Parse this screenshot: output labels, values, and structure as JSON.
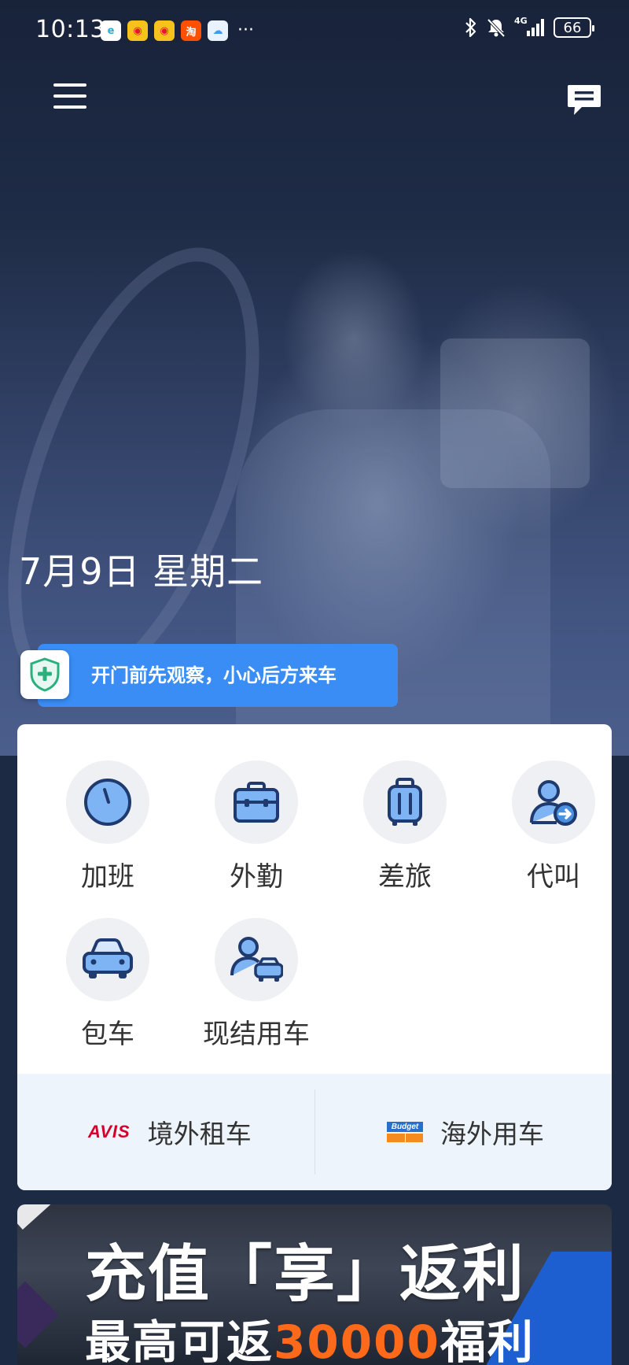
{
  "status_bar": {
    "time": "10:13",
    "apps": [
      {
        "icon": "app-e-icon",
        "label": "e",
        "color": "#2aa8d8"
      },
      {
        "icon": "weibo-icon",
        "label": "◉",
        "color": "#e6162d"
      },
      {
        "icon": "weibo-icon",
        "label": "◉",
        "color": "#e6162d"
      },
      {
        "icon": "taobao-icon",
        "label": "淘",
        "color": "#ff5000"
      },
      {
        "icon": "weather-icon",
        "label": "☁",
        "color": "#3c9cf0"
      }
    ],
    "more": "···",
    "network": "4G",
    "battery": "66"
  },
  "date_text": "7月9日 星期二",
  "safety_tip": "开门前先观察，小心后方来车",
  "services": [
    {
      "label": "加班",
      "icon": "clock-icon"
    },
    {
      "label": "外勤",
      "icon": "briefcase-icon"
    },
    {
      "label": "差旅",
      "icon": "luggage-icon"
    },
    {
      "label": "代叫",
      "icon": "user-forward-icon"
    },
    {
      "label": "包车",
      "icon": "car-icon"
    },
    {
      "label": "现结用车",
      "icon": "user-car-icon"
    }
  ],
  "partners": {
    "avis": {
      "logo": "AVIS",
      "label": "境外租车"
    },
    "budget": {
      "logo": "Budget",
      "label": "海外用车"
    }
  },
  "banner": {
    "title": "充值「享」返利",
    "sub_prefix": "最高可返",
    "sub_highlight": "30000",
    "sub_suffix": "福利"
  },
  "colors": {
    "accent": "#3a8df5",
    "icon_blue": "#4a90e2",
    "icon_dark": "#1e3a6e",
    "highlight": "#ff6a1a"
  }
}
